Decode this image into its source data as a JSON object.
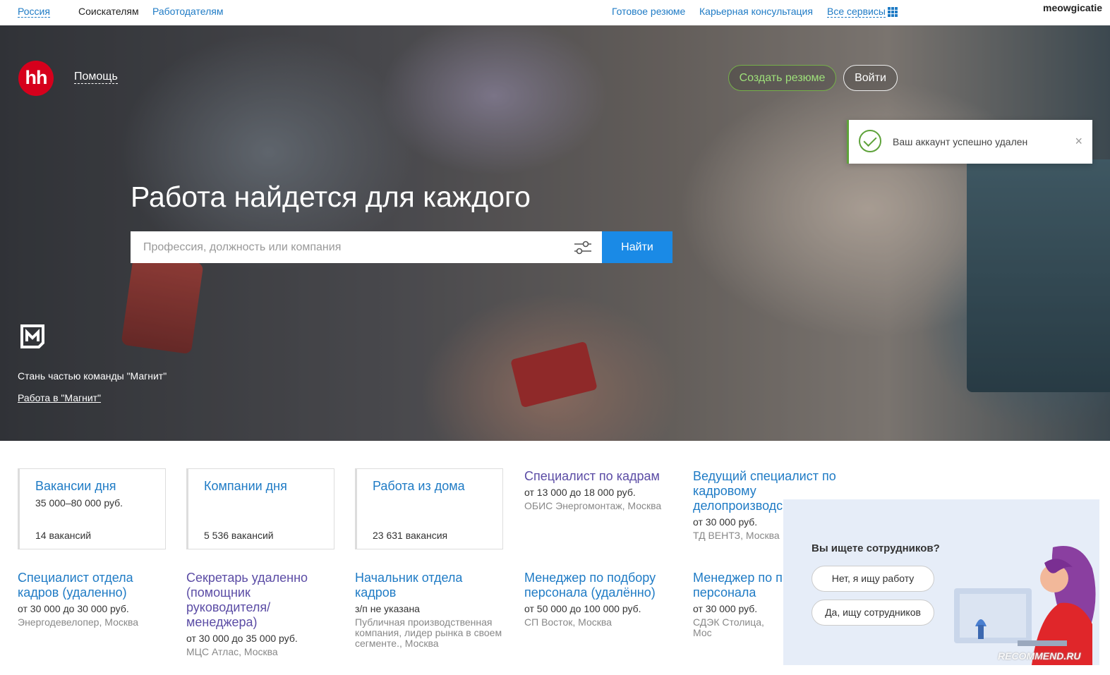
{
  "topnav": {
    "region": "Россия",
    "seekers": "Соискателям",
    "employers": "Работодателям",
    "ready_resume": "Готовое резюме",
    "career": "Карьерная консультация",
    "all_services": "Все сервисы",
    "username": "meowgicatie"
  },
  "header": {
    "logo": "hh",
    "help": "Помощь",
    "create_resume": "Создать резюме",
    "login": "Войти"
  },
  "toast": {
    "message": "Ваш аккаунт успешно удален",
    "close": "×"
  },
  "hero": {
    "title": "Работа найдется для каждого",
    "search_placeholder": "Профессия, должность или компания",
    "search_button": "Найти",
    "promo_text": "Стань частью команды \"Магнит\"",
    "promo_link": "Работа в \"Магнит\""
  },
  "tiles": [
    {
      "title": "Вакансии дня",
      "sub": "35 000–80 000 руб.",
      "count": "14 вакансий"
    },
    {
      "title": "Компании дня",
      "sub": "",
      "count": "5 536 вакансий"
    },
    {
      "title": "Работа из дома",
      "sub": "",
      "count": "23 631 вакансия"
    }
  ],
  "vacancies": [
    {
      "title": "Специалист по кадрам",
      "salary": "от 13 000 до 18 000 руб.",
      "company": "ОБИС Энергомонтаж, Москва"
    },
    {
      "title": "Ведущий специалист по кадровому делопроизводс",
      "salary": "от 30 000 руб.",
      "company": "ТД ВЕНТЗ, Москва"
    },
    {
      "title": "Специалист отдела кадров (удаленно)",
      "salary": "от 30 000 до 30 000 руб.",
      "company": "Энергодевелопер, Москва"
    },
    {
      "title": "Секретарь удаленно (помощник руководителя/ менеджера)",
      "salary": "от 30 000 до 35 000 руб.",
      "company": "МЦС Атлас, Москва"
    },
    {
      "title": "Начальник отдела кадров",
      "salary": "з/п не указана",
      "company": "Публичная производственная компания, лидер рынка в своем сегменте., Москва"
    },
    {
      "title": "Менеджер по подбору персонала (удалённо)",
      "salary": "от 50 000 до 100 000 руб.",
      "company": "СП Восток, Москва"
    },
    {
      "title": "Менеджер по п персонала",
      "salary": "от 30 000 руб.",
      "company": "СДЭК Столица, Мос"
    }
  ],
  "employer_popup": {
    "question": "Вы ищете сотрудников?",
    "no": "Нет, я ищу работу",
    "yes": "Да, ищу сотрудников"
  },
  "watermark": "RECOMMEND.RU",
  "colors": {
    "brand_red": "#d6001c",
    "link_blue": "#1f7bc5",
    "search_button": "#1a8ae6",
    "success_green": "#5ea23a",
    "visited_link": "#5b4ca5"
  }
}
